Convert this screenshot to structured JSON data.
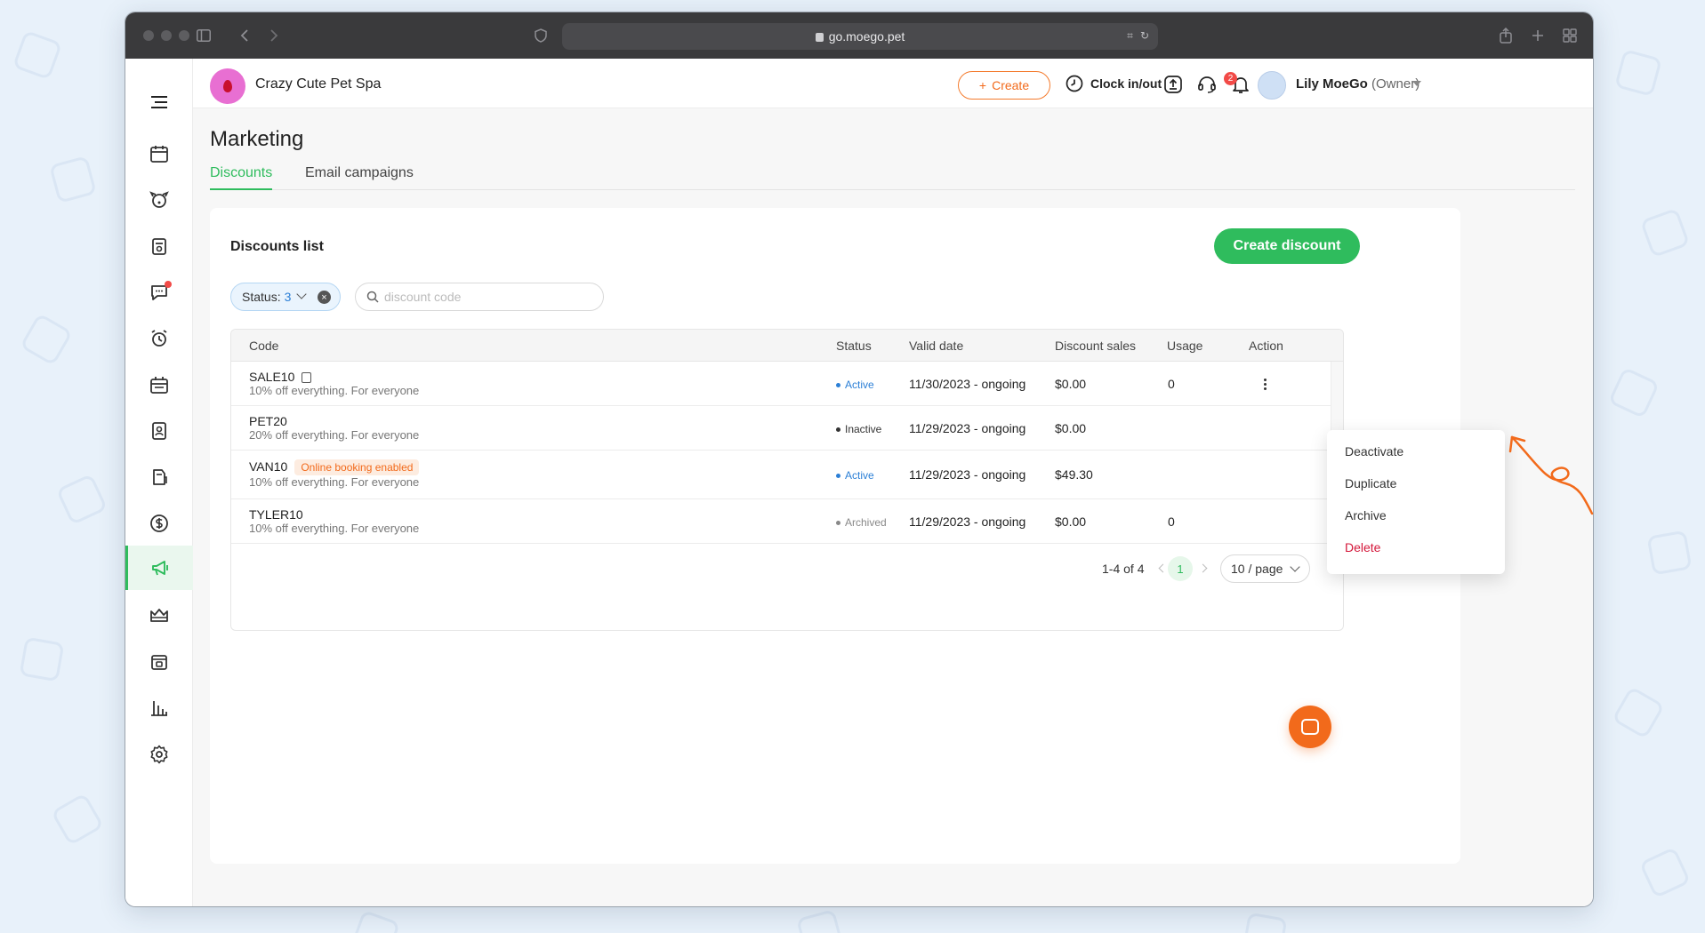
{
  "browser": {
    "url": "go.moego.pet"
  },
  "topbar": {
    "business_name": "Crazy Cute Pet Spa",
    "create_label": "Create",
    "clock_label": "Clock in/out",
    "notification_count": "2",
    "user_name": "Lily MoeGo",
    "user_role": "(Owner)"
  },
  "page": {
    "title": "Marketing",
    "tabs": [
      {
        "label": "Discounts",
        "active": true
      },
      {
        "label": "Email campaigns",
        "active": false
      }
    ]
  },
  "discounts": {
    "list_title": "Discounts list",
    "create_button": "Create discount",
    "status_filter_label": "Status:",
    "status_filter_count": "3",
    "search_placeholder": "discount code",
    "search_value": "",
    "columns": [
      "Code",
      "Status",
      "Valid date",
      "Discount sales",
      "Usage",
      "Action"
    ],
    "rows": [
      {
        "code": "SALE10",
        "description": "10% off everything. For everyone",
        "status": "Active",
        "valid": "11/30/2023 - ongoing",
        "sales": "$0.00",
        "usage": "0",
        "tag": ""
      },
      {
        "code": "PET20",
        "description": "20% off everything. For everyone",
        "status": "Inactive",
        "valid": "11/29/2023 - ongoing",
        "sales": "$0.00",
        "usage": "",
        "tag": ""
      },
      {
        "code": "VAN10",
        "description": "10% off everything. For everyone",
        "status": "Active",
        "valid": "11/29/2023 - ongoing",
        "sales": "$49.30",
        "usage": "",
        "tag": "Online booking enabled"
      },
      {
        "code": "TYLER10",
        "description": "10% off everything. For everyone",
        "status": "Archived",
        "valid": "11/29/2023 - ongoing",
        "sales": "$0.00",
        "usage": "0",
        "tag": ""
      }
    ],
    "pagination": {
      "range": "1-4 of 4",
      "current_page": "1",
      "page_size": "10 / page"
    }
  },
  "action_menu": {
    "items": [
      "Deactivate",
      "Duplicate",
      "Archive",
      "Delete"
    ]
  },
  "colors": {
    "brand_green": "#2fbc5d",
    "accent_orange": "#f26a1b",
    "active_blue": "#2b7fd6",
    "danger_red": "#d4173a"
  },
  "icons": {
    "sidebar": [
      "menu-icon",
      "calendar-icon",
      "pet-icon",
      "booking-icon",
      "message-icon",
      "alarm-icon",
      "schedule-icon",
      "report-card-icon",
      "retail-icon",
      "payment-icon",
      "marketing-icon",
      "membership-icon",
      "agreement-icon",
      "reports-icon",
      "settings-icon"
    ]
  }
}
